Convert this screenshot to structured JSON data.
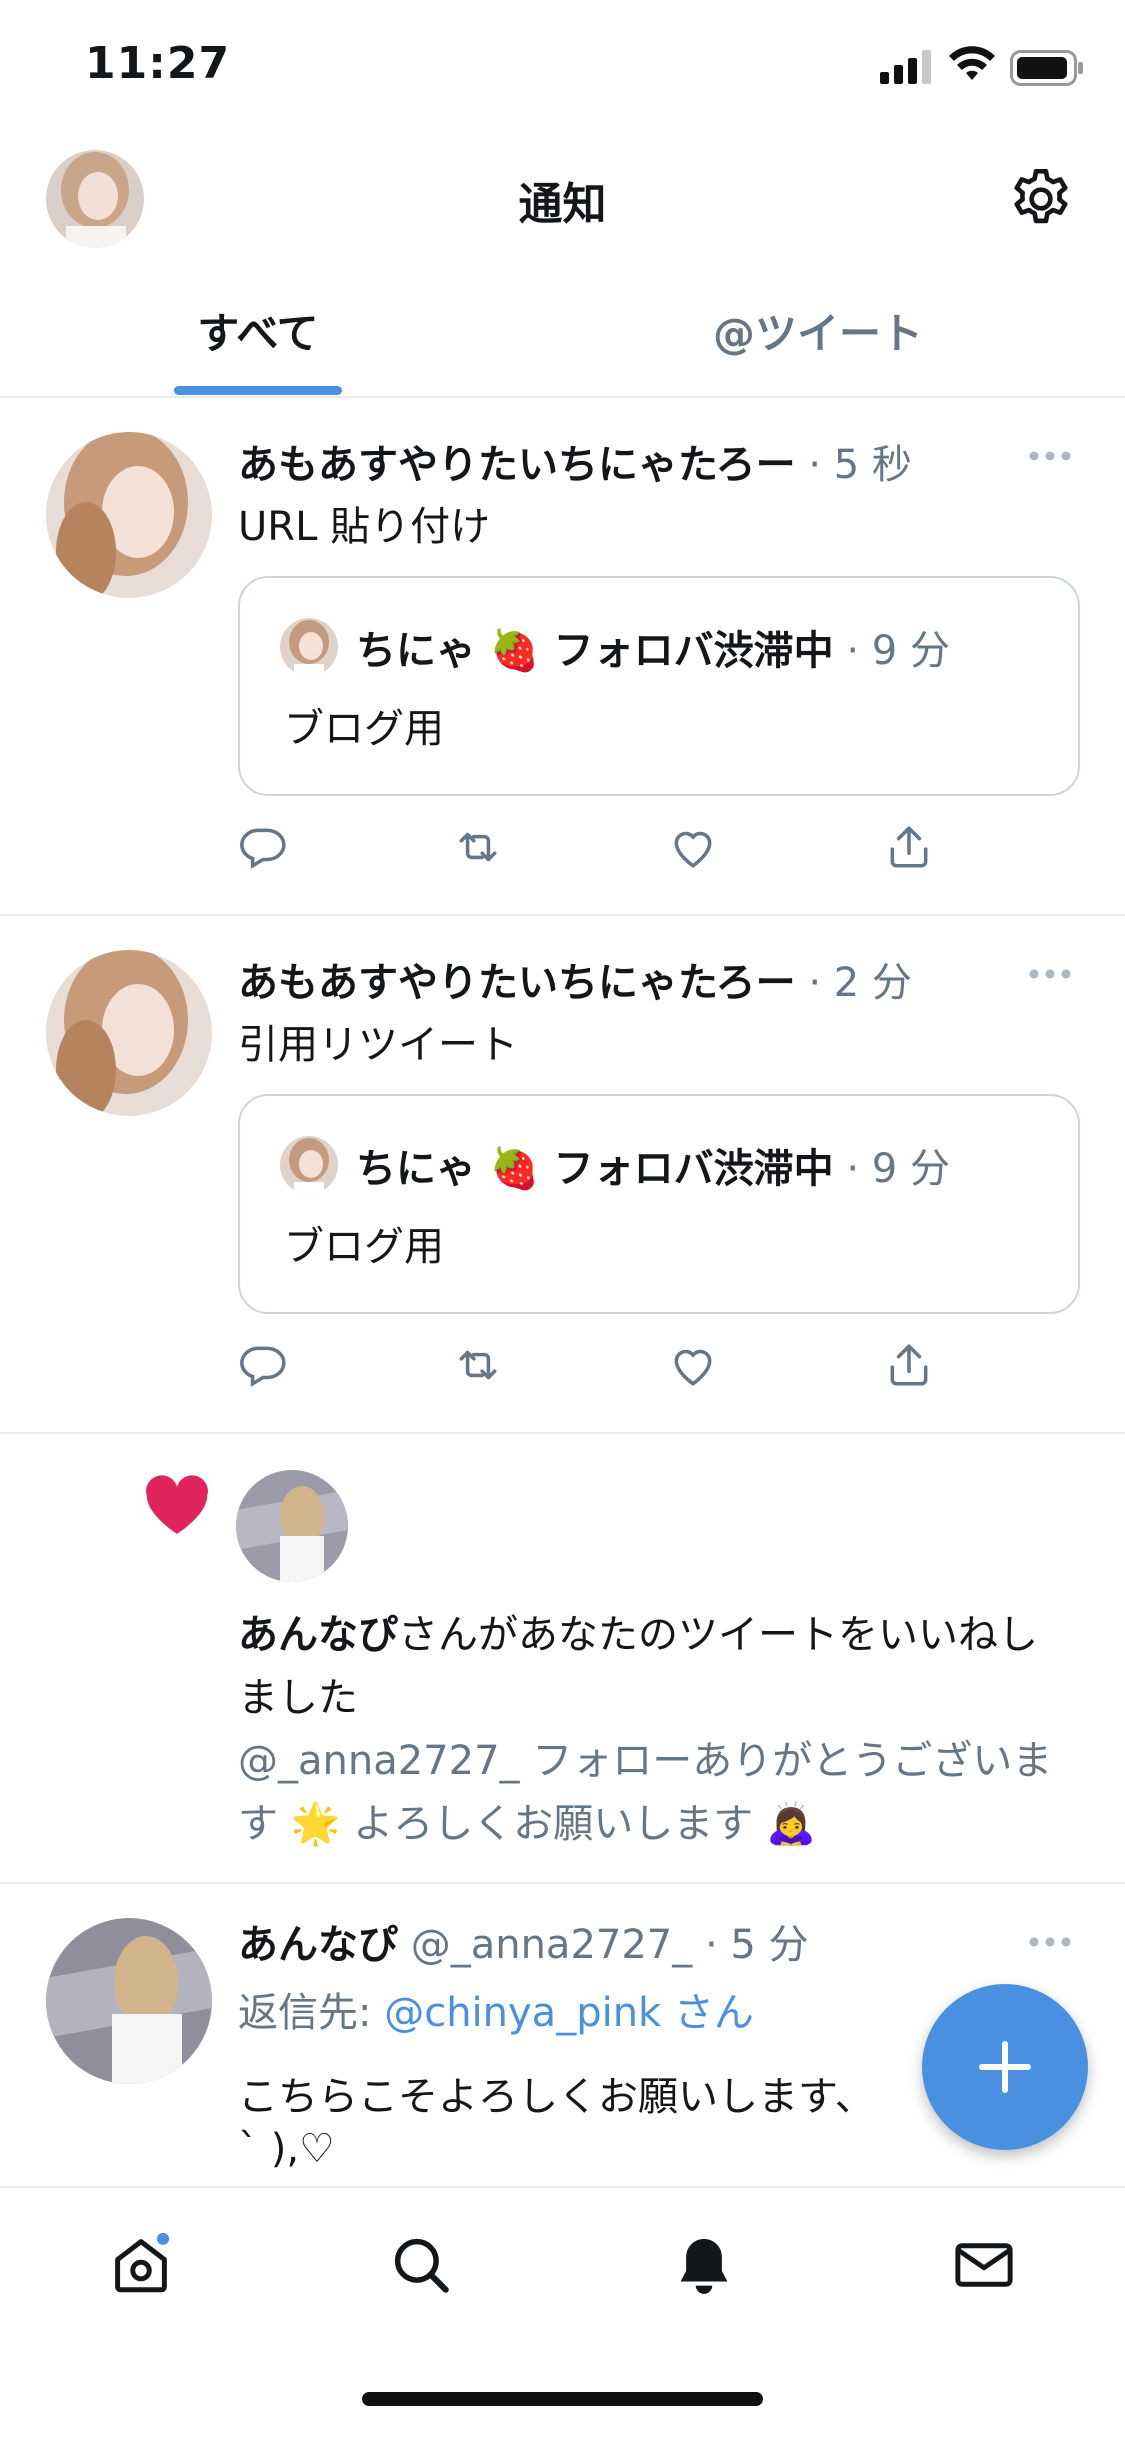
{
  "status_bar": {
    "time": "11:27"
  },
  "header": {
    "title": "通知"
  },
  "tabs": [
    {
      "label": "すべて",
      "active": true
    },
    {
      "label": "@ツイート",
      "active": false
    }
  ],
  "tweets": [
    {
      "name": "あもあすやりたいちにゃたろー",
      "time": "· 5 秒",
      "text": "URL 貼り付け",
      "quote": {
        "name": "ちにゃ 🍓 フォロバ渋滞中",
        "time": "· 9 分",
        "text": "ブログ用"
      }
    },
    {
      "name": "あもあすやりたいちにゃたろー",
      "time": "· 2 分",
      "text": "引用リツイート",
      "quote": {
        "name": "ちにゃ 🍓 フォロバ渋滞中",
        "time": "· 9 分",
        "text": "ブログ用"
      }
    }
  ],
  "like_notification": {
    "user": "あんなぴ",
    "message": "さんがあなたのツイートをいいねしました",
    "tweet_text": "@_anna2727_ フォローありがとうございます 🌟 よろしくお願いします 🙇‍♀️"
  },
  "reply_tweet": {
    "name": "あんなぴ",
    "handle": "@_anna2727_",
    "time": "· 5 分",
    "reply_prefix": "返信先: ",
    "reply_to": "@chinya_pink",
    "reply_suffix": " さん",
    "text_line1": "こちらこそよろしくお願いします、",
    "text_line2": "` ),♡"
  },
  "colors": {
    "accent": "#4a90e2",
    "like": "#e0245e",
    "text": "#14171a",
    "secondary": "#657786",
    "divider": "#e6ecf0"
  },
  "icons": [
    "profile-avatar",
    "gear-icon",
    "more-icon",
    "reply-icon",
    "retweet-icon",
    "like-icon",
    "share-icon",
    "heart-icon",
    "compose-icon",
    "home-icon",
    "search-icon",
    "bell-icon",
    "mail-icon"
  ]
}
